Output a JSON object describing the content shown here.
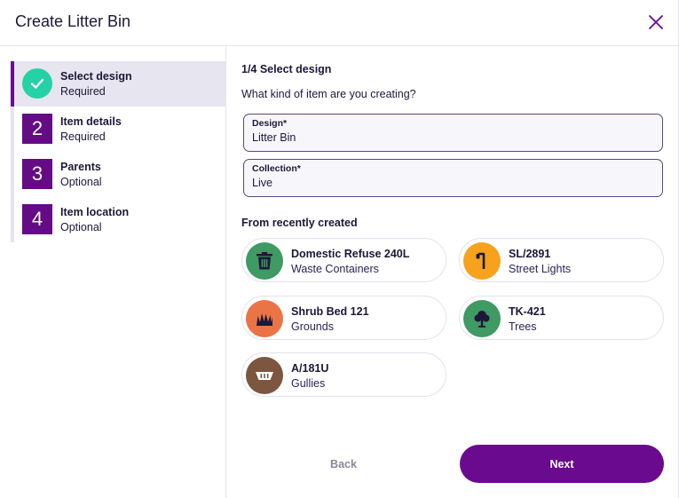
{
  "dialog": {
    "title": "Create Litter Bin"
  },
  "steps": [
    {
      "title": "Select design",
      "status": "Required",
      "number": "1",
      "state": "completed"
    },
    {
      "title": "Item details",
      "status": "Required",
      "number": "2",
      "state": "pending"
    },
    {
      "title": "Parents",
      "status": "Optional",
      "number": "3",
      "state": "pending"
    },
    {
      "title": "Item location",
      "status": "Optional",
      "number": "4",
      "state": "pending"
    }
  ],
  "main": {
    "step_heading": "1/4 Select design",
    "question": "What kind of item are you creating?",
    "design_field": {
      "label": "Design*",
      "value": "Litter Bin"
    },
    "collection_field": {
      "label": "Collection*",
      "value": "Live"
    },
    "recent_heading": "From recently created",
    "recent": [
      {
        "name": "Domestic Refuse 240L",
        "category": "Waste Containers",
        "color": "#3f9a63",
        "icon": "trash-bin-icon"
      },
      {
        "name": "SL/2891",
        "category": "Street Lights",
        "color": "#f7a21d",
        "icon": "street-light-icon"
      },
      {
        "name": "Shrub Bed 121",
        "category": "Grounds",
        "color": "#ea7446",
        "icon": "grass-icon"
      },
      {
        "name": "TK-421",
        "category": "Trees",
        "color": "#3f9a63",
        "icon": "tree-icon"
      },
      {
        "name": "A/181U",
        "category": "Gullies",
        "color": "#7c563f",
        "icon": "gully-icon"
      }
    ],
    "back_label": "Back",
    "next_label": "Next"
  },
  "colors": {
    "accent": "#6a0a8f",
    "check": "#25d1a6"
  }
}
